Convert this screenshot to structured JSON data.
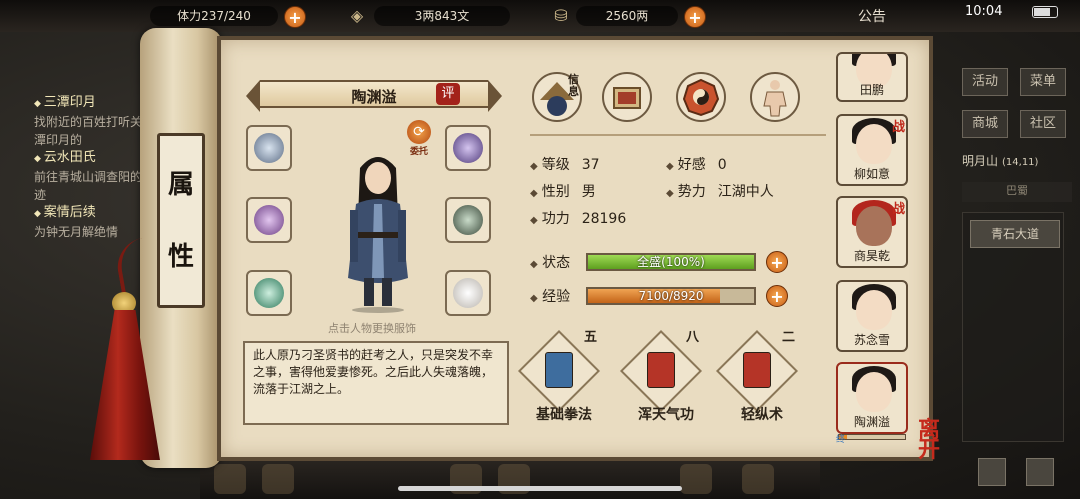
{
  "topbar": {
    "stamina_text": "体力237/240",
    "copper_text": "3两843文",
    "silver_text": "2560两",
    "notice_label": "公告",
    "clock": "10:04"
  },
  "quests": [
    {
      "title": "三潭印月",
      "desc": "找附近的百姓打听关三潭印月的"
    },
    {
      "title": "云水田氏",
      "desc": "前往青城山调查阳的踪迹"
    },
    {
      "title": "案情后续",
      "desc": "为钟无月解绝情"
    }
  ],
  "right_menu": {
    "activity": "活动",
    "menu": "菜单",
    "shop": "商城",
    "community": "社区",
    "location": "明月山",
    "coords": "(14,11)",
    "bazhu": "巴蜀",
    "road": "青石大道"
  },
  "scroll": {
    "seal_chars": [
      "属",
      "性"
    ]
  },
  "hero": {
    "name": "陶渊溢",
    "eval_label": "评",
    "entrust_label": "委托",
    "change_hint": "点击人物更换服饰",
    "bio": "此人原乃刁圣贤书的赶考之人，只是突发不幸之事，害得他爱妻惨死。之后此人失魂落魄，流落于江湖之上。"
  },
  "tabs": {
    "info_label": "信息"
  },
  "stats": {
    "level_label": "等级",
    "level_value": "37",
    "favor_label": "好感",
    "favor_value": "0",
    "gender_label": "性别",
    "gender_value": "男",
    "faction_label": "势力",
    "faction_value": "江湖中人",
    "power_label": "功力",
    "power_value": "28196",
    "status_label": "状态",
    "status_text": "全盛(100%)",
    "status_fraction": 1.0,
    "exp_label": "经验",
    "exp_text": "7100/8920",
    "exp_fraction": 0.796
  },
  "skills": [
    {
      "name": "基础拳法",
      "level": "五",
      "color": "#3e6d9e"
    },
    {
      "name": "浑天气功",
      "level": "八",
      "color": "#b53427"
    },
    {
      "name": "轻纵术",
      "level": "二",
      "color": "#b53427"
    }
  ],
  "companions": [
    {
      "name": "田鹏"
    },
    {
      "name": "柳如意",
      "battle": "战"
    },
    {
      "name": "商昊乾",
      "battle": "战"
    },
    {
      "name": "苏念雪"
    },
    {
      "name": "陶渊溢"
    }
  ],
  "leave_label": "离开",
  "companion_bar_label": "终"
}
